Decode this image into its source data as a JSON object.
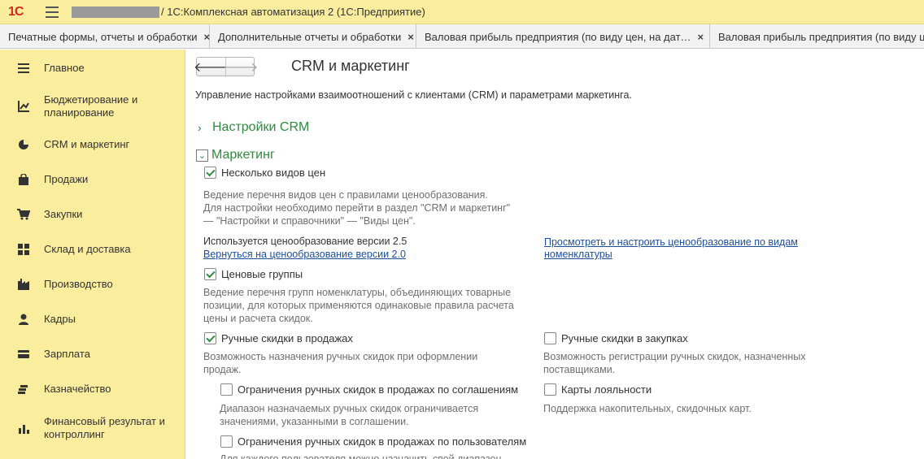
{
  "titlebar": {
    "logo": "1С",
    "title": "/ 1С:Комплексная автоматизация 2  (1С:Предприятие)"
  },
  "tabs": [
    {
      "label": "Печатные формы, отчеты и обработки"
    },
    {
      "label": "Дополнительные отчеты и обработки"
    },
    {
      "label": "Валовая прибыль предприятия (по виду цен, на дат…"
    },
    {
      "label": "Валовая прибыль предприятия (по виду цен"
    }
  ],
  "tab_close": "×",
  "sidebar": {
    "items": [
      {
        "label": "Главное",
        "icon": "menu-list-icon"
      },
      {
        "label": "Бюджетирование и планирование",
        "icon": "budget-chart-icon"
      },
      {
        "label": "CRM и маркетинг",
        "icon": "pie-chart-icon"
      },
      {
        "label": "Продажи",
        "icon": "shopping-bag-icon"
      },
      {
        "label": "Закупки",
        "icon": "cart-icon"
      },
      {
        "label": "Склад и доставка",
        "icon": "warehouse-grid-icon"
      },
      {
        "label": "Производство",
        "icon": "factory-icon"
      },
      {
        "label": "Кадры",
        "icon": "person-icon"
      },
      {
        "label": "Зарплата",
        "icon": "wallet-icon"
      },
      {
        "label": "Казначейство",
        "icon": "coins-icon"
      },
      {
        "label": "Финансовый результат и контроллинг",
        "icon": "bar-chart-icon"
      }
    ]
  },
  "content": {
    "title": "CRM и маркетинг",
    "description": "Управление настройками взаимоотношений с клиентами (CRM) и параметрами маркетинга.",
    "groups": {
      "crm": "Настройки CRM",
      "marketing": "Маркетинг"
    },
    "price_kinds": {
      "label": "Несколько видов цен",
      "checked": true,
      "hint_1": "Ведение перечня видов цен с правилами ценообразования.",
      "hint_2": "Для настройки необходимо перейти в раздел \"CRM и маркетинг\"",
      "hint_3": "— \"Настройки и справочники\" — \"Виды цен\"."
    },
    "pricing_version": {
      "text": "Используется ценообразование версии 2.5",
      "link_back": "Вернуться на ценообразование версии 2.0",
      "link_view_1": "Просмотреть и настроить ценообразование по видам",
      "link_view_2": "номенклатуры"
    },
    "price_groups": {
      "label": "Ценовые группы",
      "checked": true,
      "hint_1": "Ведение перечня групп номенклатуры, объединяющих товарные",
      "hint_2": "позиции, для которых применяются одинаковые правила расчета",
      "hint_3": "цены и расчета скидок."
    },
    "manual_discounts_sales": {
      "label": "Ручные скидки в продажах",
      "checked": true,
      "hint_1": "Возможность назначения ручных скидок при оформлении",
      "hint_2": "продаж."
    },
    "manual_discounts_purchases": {
      "label": "Ручные скидки в закупках",
      "checked": false,
      "hint_1": "Возможность регистрации ручных скидок, назначенных",
      "hint_2": "поставщиками."
    },
    "limit_by_agreements": {
      "label": "Ограничения ручных скидок в продажах по соглашениям",
      "checked": false,
      "hint_1": "Диапазон назначаемых ручных скидок ограничивается",
      "hint_2": "значениями, указанными в соглашении."
    },
    "loyalty_cards": {
      "label": "Карты лояльности",
      "checked": false,
      "hint_1": "Поддержка накопительных, скидочных карт."
    },
    "limit_by_users": {
      "label": "Ограничения ручных скидок в продажах по пользователям",
      "checked": false,
      "hint_1": "Для каждого пользователя можно назначить свой диапазон"
    }
  },
  "colors": {
    "accent_green": "#2e8b3d",
    "sidebar_bg": "#fbed9e",
    "link": "#1c4f9c"
  }
}
